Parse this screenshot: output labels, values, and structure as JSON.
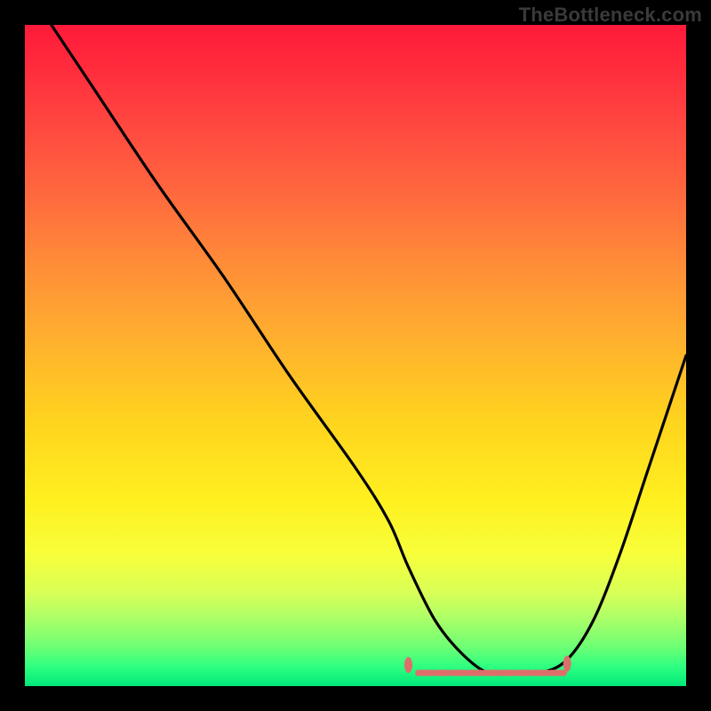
{
  "watermark": "TheBottleneck.com",
  "chart_data": {
    "type": "line",
    "title": "",
    "xlabel": "",
    "ylabel": "",
    "xlim": [
      0,
      100
    ],
    "ylim": [
      0,
      100
    ],
    "grid": false,
    "legend": false,
    "series": [
      {
        "name": "bottleneck-curve",
        "x": [
          4,
          10,
          20,
          30,
          40,
          50,
          55,
          58,
          62,
          66,
          70,
          74,
          78,
          82,
          86,
          90,
          94,
          98,
          100
        ],
        "y": [
          100,
          91,
          76,
          62,
          47,
          33,
          25,
          18,
          10,
          5,
          2,
          2,
          2,
          4,
          10,
          20,
          32,
          44,
          50
        ]
      }
    ],
    "markers": [
      {
        "name": "optimal-range-left",
        "shape": "circle",
        "x": 58,
        "y": 3.2,
        "color": "#de6e6a"
      },
      {
        "name": "optimal-range-right",
        "shape": "circle",
        "x": 82,
        "y": 3.4,
        "color": "#de6e6a"
      }
    ],
    "bottom_band_segments": {
      "color": "#de6e6a",
      "y": 2.0,
      "x_pairs": [
        [
          59.5,
          61.5
        ],
        [
          62,
          64
        ],
        [
          64.5,
          66.5
        ],
        [
          67,
          69
        ],
        [
          69.5,
          71.5
        ],
        [
          72,
          74
        ],
        [
          74.5,
          76.5
        ],
        [
          77,
          79
        ],
        [
          79.5,
          81.5
        ]
      ]
    },
    "colors": {
      "curve": "#000000",
      "background_top": "#ff1a3a",
      "background_bottom": "#00e87a",
      "frame": "#000000"
    }
  }
}
